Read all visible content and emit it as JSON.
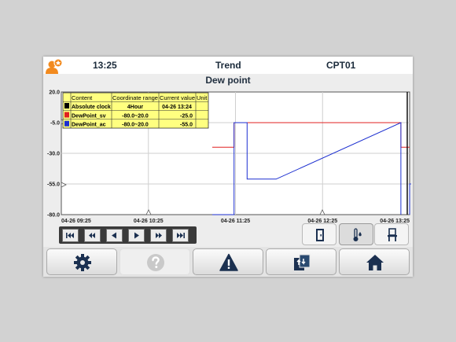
{
  "header": {
    "time": "13:25",
    "title": "Trend",
    "device": "CPT01"
  },
  "chart_title": "Dew point",
  "legend": {
    "headers": [
      "Content",
      "Coordinate range",
      "Current value",
      "Unit"
    ],
    "rows": [
      {
        "color": "#000000",
        "content": "Absolute clock",
        "range": "4Hour",
        "value": "04-26 13:24",
        "unit": ""
      },
      {
        "color": "#e02020",
        "content": "DewPoint_sv",
        "range": "-80.0~20.0",
        "value": "-25.0",
        "unit": ""
      },
      {
        "color": "#1c2fd0",
        "content": "DewPoint_ac",
        "range": "-80.0~20.0",
        "value": "-55.0",
        "unit": ""
      }
    ]
  },
  "chart_data": {
    "type": "line",
    "title": "Dew point",
    "ylim": [
      -80,
      20
    ],
    "y_ticks": [
      "20.0",
      "-5.0",
      "-30.0",
      "-55.0",
      "-80.0"
    ],
    "x_tick_labels": [
      "04-26 09:25",
      "04-26 10:25",
      "04-26 11:25",
      "04-26 12:25",
      "04-26 13:25"
    ],
    "xlim": [
      "04-26 09:25",
      "04-26 13:25"
    ],
    "grid": true,
    "series": [
      {
        "name": "DewPoint_sv",
        "color": "#e02020",
        "segments": [
          [
            [
              "04-26 11:09",
              -25
            ],
            [
              "04-26 11:24",
              -25
            ],
            [
              "04-26 11:24",
              -5
            ],
            [
              "04-26 13:19",
              -5
            ],
            [
              "04-26 13:19",
              -25
            ],
            [
              "04-26 13:25",
              -25
            ]
          ]
        ]
      },
      {
        "name": "DewPoint_ac",
        "color": "#1c2fd0",
        "segments": [
          [
            [
              "04-26 11:09",
              -80
            ],
            [
              "04-26 11:24",
              -80
            ],
            [
              "04-26 11:24",
              -5
            ],
            [
              "04-26 11:33",
              -5
            ],
            [
              "04-26 11:33",
              -51
            ],
            [
              "04-26 11:53",
              -51
            ],
            [
              "04-26 13:19",
              -5
            ],
            [
              "04-26 13:19",
              -80
            ]
          ],
          [
            [
              "04-26 13:25",
              -80
            ],
            [
              "04-26 13:25",
              -55
            ],
            [
              "04-26 13:26",
              -55
            ]
          ]
        ]
      }
    ]
  },
  "nav_buttons": [
    "jump-first",
    "page-back",
    "step-back",
    "step-forward",
    "page-forward",
    "jump-last"
  ],
  "icons": {
    "user": "user-star-icon",
    "settings": "gear-icon",
    "help": "question-icon",
    "alarm": "warning-icon",
    "transfer": "swap-icon",
    "home": "home-icon"
  },
  "colors": {
    "navy": "#1b3050",
    "orange": "#f28a1e"
  }
}
